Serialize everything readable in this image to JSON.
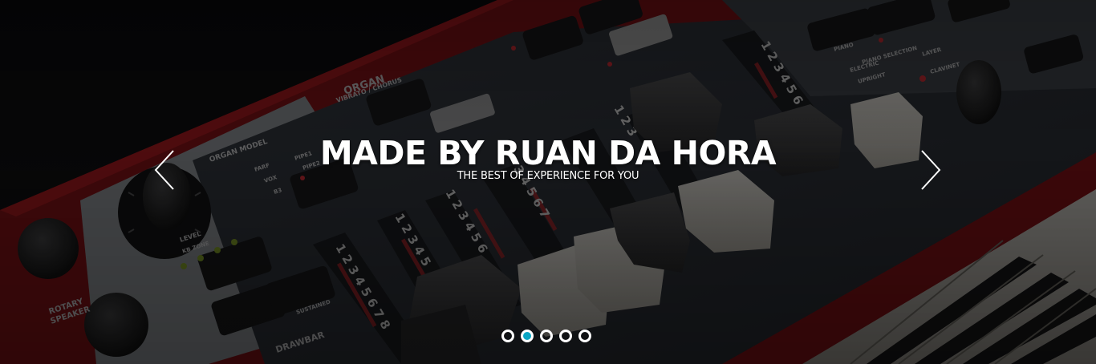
{
  "slider": {
    "title": "MADE BY RUAN DA HORA",
    "subtitle": "THE BEST OF EXPERIENCE FOR YOU",
    "prev_icon": "chevron-left-icon",
    "next_icon": "chevron-right-icon",
    "indicators": {
      "count": 5,
      "active_index": 1
    },
    "colors": {
      "active_indicator": "#0aa6c4",
      "indicator_border": "#ffffff",
      "text": "#ffffff",
      "instrument_red": "#a3151b"
    },
    "image_text": {
      "organ": "ORGAN",
      "vibrato_chorus": "VIBRATO / CHORUS",
      "organ_model": "ORGAN MODEL",
      "farf": "FARF",
      "vox": "VOX",
      "b3": "B3",
      "pipe1": "PIPE1",
      "pipe2": "PIPE2",
      "level": "LEVEL",
      "kb_zone": "KB ZONE",
      "rotary_speaker": "ROTARY SPEAKER",
      "sustained": "SUSTAINED",
      "drawbar": "DRAWBAR",
      "piano": "PIANO",
      "electric": "ELECTRIC",
      "upright": "UPRIGHT",
      "clavinet": "CLAVINET",
      "layer": "LAYER",
      "piano_selection": "PIANO SELECTION"
    }
  }
}
